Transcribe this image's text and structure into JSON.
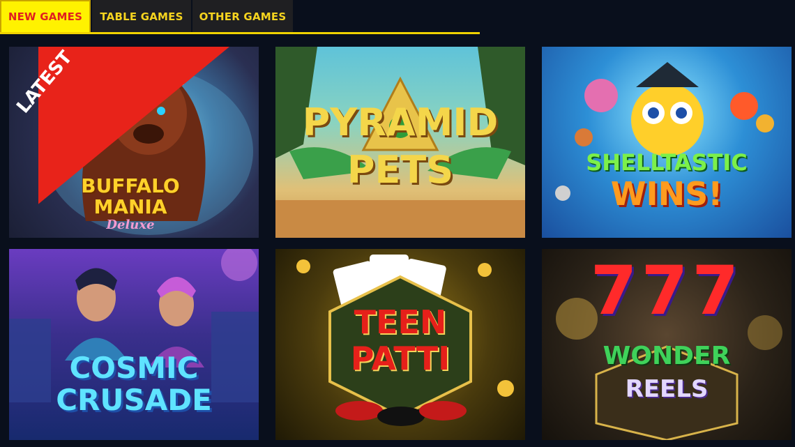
{
  "tabs": [
    {
      "label": "NEW GAMES",
      "active": true
    },
    {
      "label": "TABLE GAMES",
      "active": false
    },
    {
      "label": "OTHER GAMES",
      "active": false
    }
  ],
  "colors": {
    "accent": "#fff200",
    "tab_active_text": "#e02020",
    "tab_text": "#f6d41f",
    "background": "#090f1c"
  },
  "games": [
    {
      "title_line1": "BUFFALO",
      "title_line2": "MANIA",
      "subtitle": "Deluxe",
      "badge": "LATEST"
    },
    {
      "title_line1": "PYRAMID",
      "title_line2": "PETS"
    },
    {
      "title_line1": "SHELLTASTIC",
      "title_line2": "WINS!"
    },
    {
      "title_line1": "COSMIC",
      "title_line2": "CRUSADE"
    },
    {
      "title_line1": "TEEN",
      "title_line2": "PATTI"
    },
    {
      "title_top": "777",
      "title_line1": "WONDER",
      "title_line2": "REELS"
    }
  ]
}
